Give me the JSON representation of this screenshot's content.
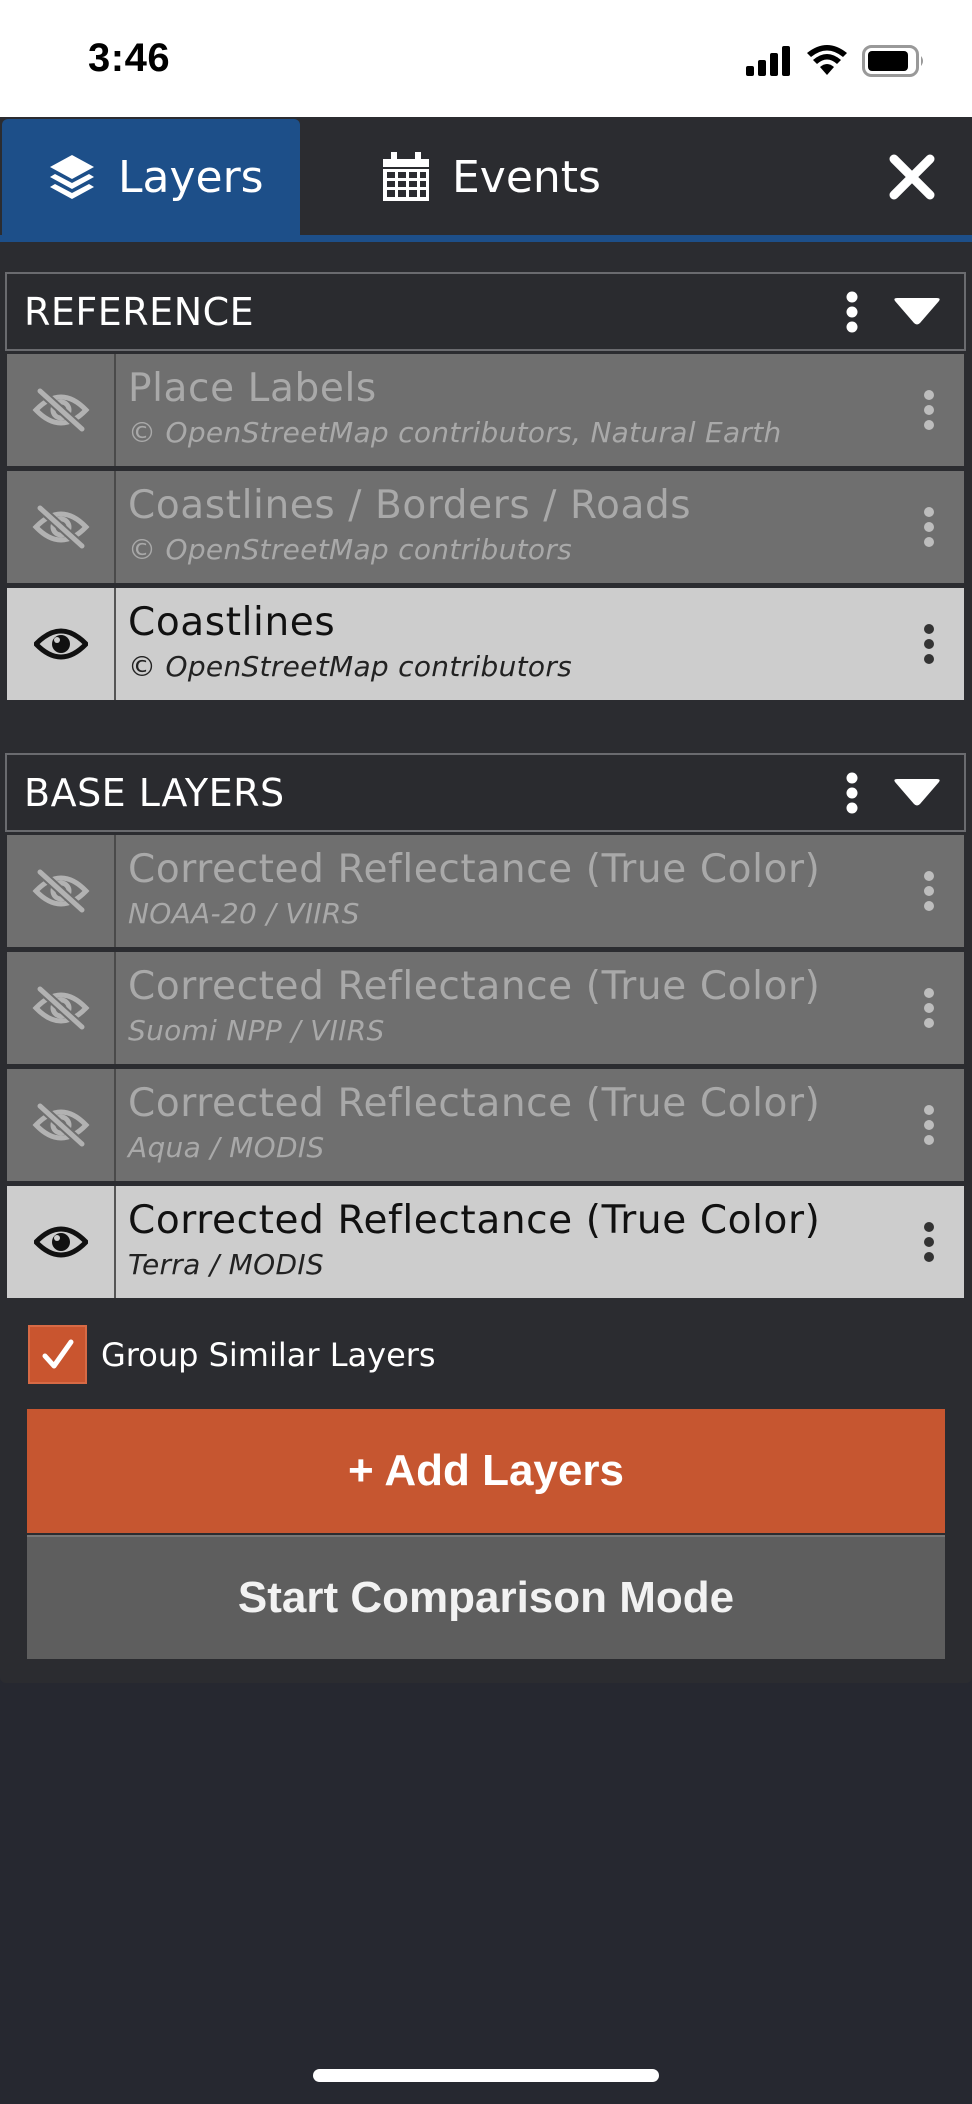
{
  "status_bar": {
    "time": "3:46"
  },
  "tabs": [
    {
      "label": "Layers",
      "icon": "layers-icon",
      "active": true
    },
    {
      "label": "Events",
      "icon": "calendar-icon",
      "active": false
    }
  ],
  "groups": [
    {
      "title": "REFERENCE",
      "layers": [
        {
          "title": "Place Labels",
          "subtitle": "© OpenStreetMap contributors, Natural Earth",
          "visible": false
        },
        {
          "title": "Coastlines / Borders / Roads",
          "subtitle": "© OpenStreetMap contributors",
          "visible": false
        },
        {
          "title": "Coastlines",
          "subtitle": "© OpenStreetMap contributors",
          "visible": true
        }
      ]
    },
    {
      "title": "BASE LAYERS",
      "layers": [
        {
          "title": "Corrected Reflectance (True Color)",
          "subtitle": "NOAA-20 / VIIRS",
          "visible": false
        },
        {
          "title": "Corrected Reflectance (True Color)",
          "subtitle": "Suomi NPP / VIIRS",
          "visible": false
        },
        {
          "title": "Corrected Reflectance (True Color)",
          "subtitle": "Aqua / MODIS",
          "visible": false
        },
        {
          "title": "Corrected Reflectance (True Color)",
          "subtitle": "Terra / MODIS",
          "visible": true
        }
      ]
    }
  ],
  "group_similar": {
    "label": "Group Similar Layers",
    "checked": true
  },
  "buttons": {
    "add_layers": "+ Add Layers",
    "comparison": "Start Comparison Mode"
  },
  "colors": {
    "accent_blue": "#1d4f89",
    "accent_orange": "#c65630",
    "hidden_row": "#6f6f6f",
    "visible_row": "#cdcdcd"
  }
}
